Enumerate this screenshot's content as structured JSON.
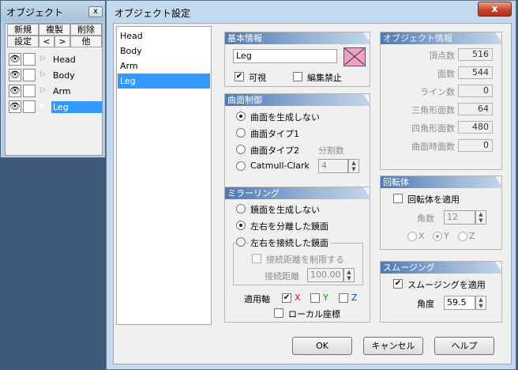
{
  "objpanel": {
    "title": "オブジェクト",
    "close": "x",
    "cmds": [
      "新規",
      "複製",
      "削除",
      "設定",
      "<",
      ">",
      "他"
    ],
    "objects": [
      {
        "name": "Head"
      },
      {
        "name": "Body"
      },
      {
        "name": "Arm"
      },
      {
        "name": "Leg"
      }
    ],
    "eye": "👁"
  },
  "dialog": {
    "title": "オブジェクト設定",
    "close": "x",
    "list": [
      "Head",
      "Body",
      "Arm",
      "Leg"
    ],
    "basic": {
      "header": "基本情報",
      "name_value": "Leg",
      "visible": "可視",
      "lock": "編集禁止"
    },
    "info": {
      "header": "オブジェクト情報",
      "rows": [
        {
          "label": "頂点数",
          "value": "516"
        },
        {
          "label": "面数",
          "value": "544"
        },
        {
          "label": "ライン数",
          "value": "0"
        },
        {
          "label": "三角形面数",
          "value": "64"
        },
        {
          "label": "四角形面数",
          "value": "480"
        },
        {
          "label": "曲面時面数",
          "value": "0"
        }
      ]
    },
    "surface": {
      "header": "曲面制御",
      "opt1": "曲面を生成しない",
      "opt2": "曲面タイプ1",
      "opt3": "曲面タイプ2",
      "opt4": "Catmull-Clark",
      "div_label": "分割数",
      "div_value": "4"
    },
    "lathe": {
      "header": "回転体",
      "apply": "回転体を適用",
      "count_label": "角数",
      "count_value": "12",
      "ax": "X",
      "ay": "Y",
      "az": "Z"
    },
    "mirror": {
      "header": "ミラーリング",
      "opt1": "鏡面を生成しない",
      "opt2": "左右を分離した鏡面",
      "opt3": "左右を接続した鏡面",
      "limit": "接続距離を制限する",
      "dist_label": "接続距離",
      "dist_value": "100.00",
      "axis_label": "適用軸",
      "ax": "X",
      "ay": "Y",
      "az": "Z",
      "local": "ローカル座標"
    },
    "smoothing": {
      "header": "スムージング",
      "apply": "スムージングを適用",
      "angle_label": "角度",
      "angle_value": "59.5"
    },
    "buttons": {
      "ok": "OK",
      "cancel": "キャンセル",
      "help": "ヘルプ"
    }
  },
  "colors": {
    "title_bar": "#c4d9ee",
    "selection": "#3399ff",
    "material_swatch": "#f0a0c8"
  }
}
